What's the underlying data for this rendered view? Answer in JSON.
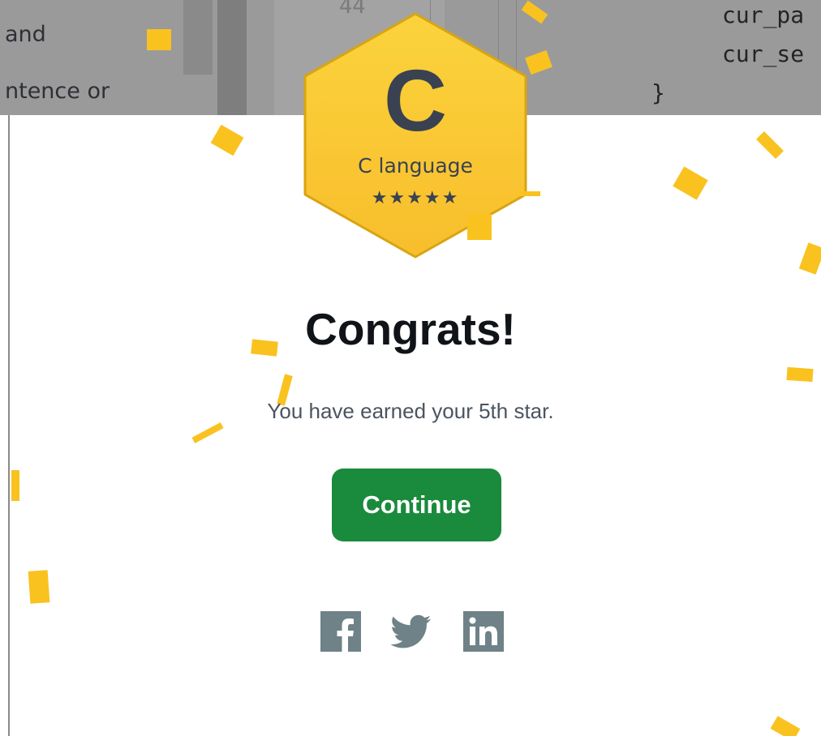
{
  "background": {
    "left_text_lines": [
      "and",
      "ntence or"
    ],
    "line_number": "44",
    "code_lines": [
      "cur_pa",
      "cur_se",
      "}"
    ]
  },
  "badge": {
    "letter": "C",
    "name": "C language",
    "stars": "★★★★★",
    "star_count": 5,
    "colors": {
      "fill": "#f9c831",
      "stroke": "#d8a412",
      "text": "#3a4252"
    }
  },
  "modal": {
    "title": "Congrats!",
    "message": "You have earned your 5th star.",
    "continue_label": "Continue",
    "share": [
      {
        "icon": "facebook-icon"
      },
      {
        "icon": "twitter-icon"
      },
      {
        "icon": "linkedin-icon"
      }
    ]
  },
  "colors": {
    "accent": "#1a8a3c",
    "confetti": "#f9c21f",
    "share_icon": "#6e8287",
    "overlay": "#9a9a9a"
  }
}
